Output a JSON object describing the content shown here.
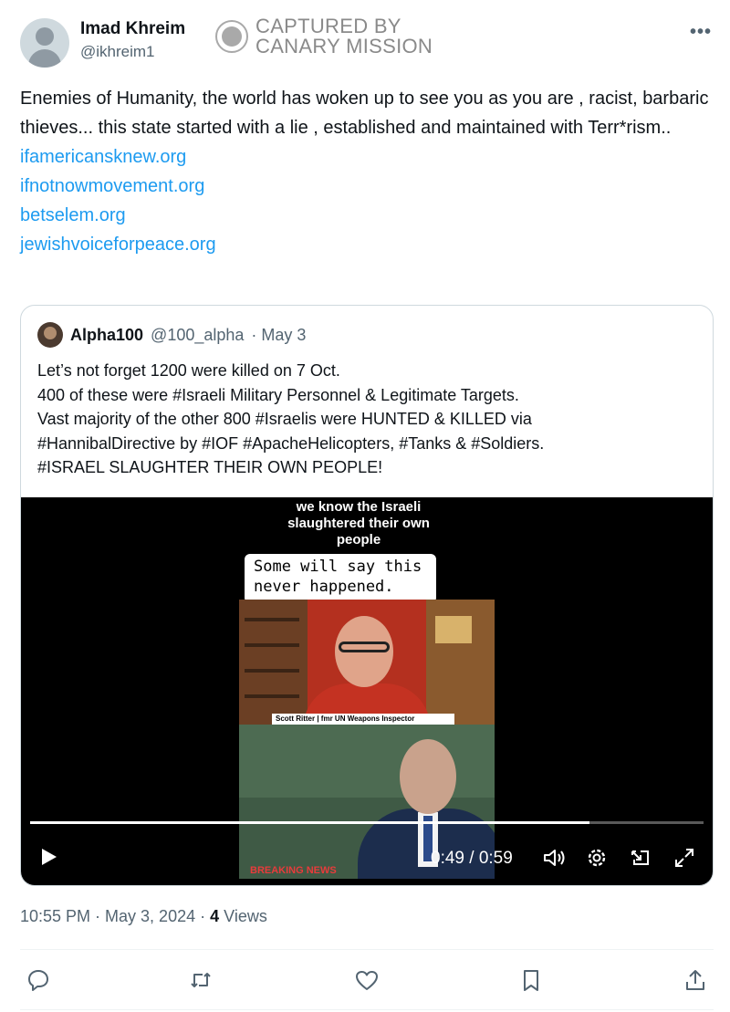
{
  "author": {
    "name": "Imad Khreim",
    "handle": "@ikhreim1"
  },
  "watermark": {
    "line1": "CAPTURED BY",
    "line2": "CANARY MISSION"
  },
  "tweet": {
    "text": "Enemies of Humanity, the world has woken up to see you as you are , racist, barbaric thieves... this state started with a lie , established and maintained with Terr*rism..",
    "links": [
      "ifamericansknew.org",
      "ifnotnowmovement.org",
      "betselem.org",
      "jewishvoiceforpeace.org"
    ]
  },
  "quote": {
    "name": "Alpha100",
    "handle": "@100_alpha",
    "date": "· May 3",
    "lines": [
      "Let’s not forget 1200 were killed on 7 Oct.",
      "400 of these were #Israeli Military Personnel & Legitimate Targets.",
      "Vast majority of the other 800 #Israelis were HUNTED & KILLED via",
      "#HannibalDirective by #IOF #ApacheHelicopters, #Tanks & #Soldiers.",
      "#ISRAEL SLAUGHTER THEIR OWN PEOPLE!"
    ]
  },
  "video": {
    "caption_top": [
      "we know the Israeli",
      "slaughtered their own",
      "people"
    ],
    "caption_bubble": [
      "Some will say this",
      "never happened."
    ],
    "lower_third": "Scott Ritter | fmr UN Weapons Inspector",
    "breaking": "BREAKING NEWS",
    "time": "0:49 / 0:59",
    "progress": 0.83
  },
  "meta": {
    "timestamp": "10:55 PM · May 3, 2024 ·",
    "views_count": "4",
    "views_label": "Views"
  },
  "colors": {
    "link": "#1d9bf0",
    "text": "#0f1419",
    "muted": "#536471",
    "border": "#cfd9de"
  },
  "icons": [
    "more-icon",
    "play-icon",
    "volume-icon",
    "settings-icon",
    "pip-icon",
    "fullscreen-icon",
    "reply-icon",
    "retweet-icon",
    "like-icon",
    "bookmark-icon",
    "share-icon"
  ]
}
